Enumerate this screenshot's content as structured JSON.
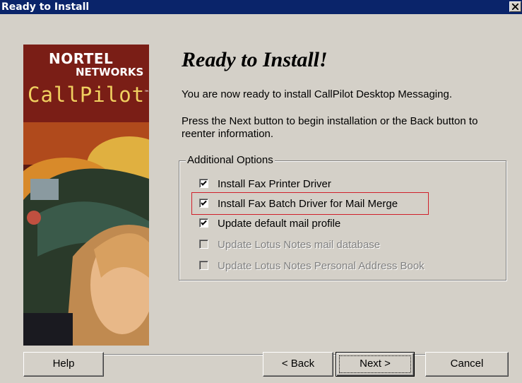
{
  "window": {
    "title": "Ready to Install",
    "close_icon": "close-icon"
  },
  "banner": {
    "logo_line1": "NORTEL",
    "logo_line2": "NETWORKS",
    "product": "CallPilot",
    "tm": "™"
  },
  "content": {
    "heading": "Ready to Install!",
    "line1": "You are now ready to install CallPilot Desktop Messaging.",
    "line2": "Press the Next button to begin installation or the Back button to reenter information."
  },
  "options": {
    "title": "Additional Options",
    "items": [
      {
        "label": "Install Fax Printer Driver",
        "checked": true,
        "enabled": true
      },
      {
        "label": "Install Fax Batch Driver for Mail Merge",
        "checked": true,
        "enabled": true,
        "highlighted": true
      },
      {
        "label": "Update default mail profile",
        "checked": true,
        "enabled": true
      },
      {
        "label": "Update Lotus Notes mail database",
        "checked": false,
        "enabled": false
      },
      {
        "label": "Update Lotus Notes Personal Address Book",
        "checked": false,
        "enabled": false
      }
    ]
  },
  "buttons": {
    "help": "Help",
    "back": "< Back",
    "next": "Next >",
    "cancel": "Cancel"
  },
  "colors": {
    "titlebar": "#0a246a",
    "face": "#d4d0c8",
    "highlight_box": "#d0202a",
    "banner": "#5a1a14"
  }
}
